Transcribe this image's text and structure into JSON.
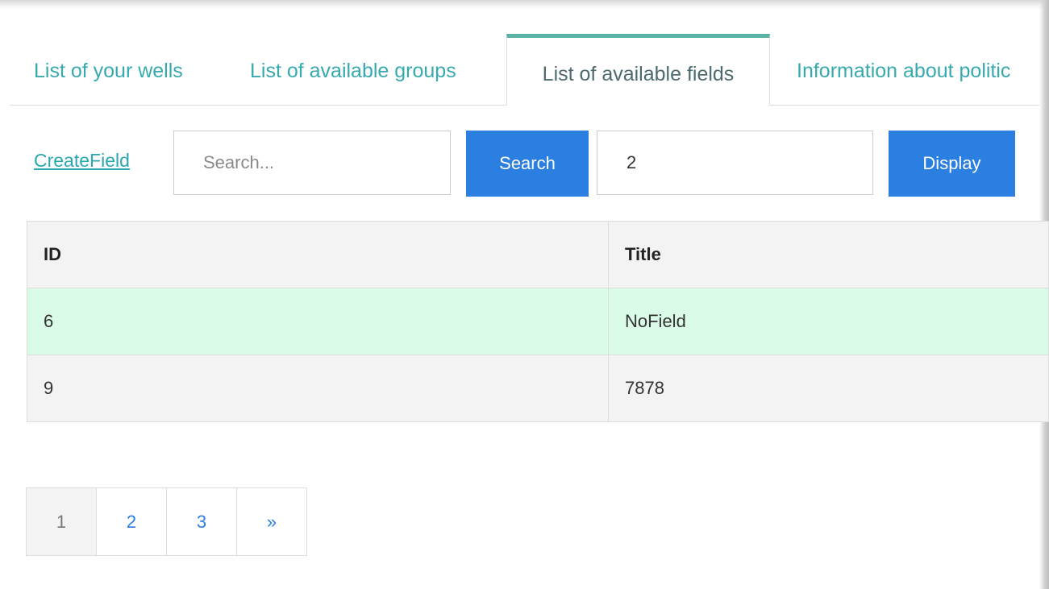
{
  "top_fragment": "' ' ' '",
  "tabs": [
    {
      "label": "List of your wells"
    },
    {
      "label": "List of available groups"
    },
    {
      "label": "List of available fields",
      "active": true
    },
    {
      "label": "Information about politic"
    }
  ],
  "toolbar": {
    "create_label": "CreateField",
    "search_placeholder": "Search...",
    "search_value": "",
    "search_button": "Search",
    "count_value": "2",
    "display_button": "Display"
  },
  "table": {
    "columns": [
      "ID",
      "Title"
    ],
    "rows": [
      {
        "id": "6",
        "title": "NoField",
        "highlighted": true
      },
      {
        "id": "9",
        "title": "7878"
      }
    ]
  },
  "pagination": {
    "pages": [
      "1",
      "2",
      "3"
    ],
    "current": "1",
    "next_label": "»"
  },
  "colors": {
    "accent": "#37aab0",
    "tab_active_border": "#5bb3a6",
    "button": "#2a7fe0",
    "row_highlight": "#dbfbe9"
  }
}
